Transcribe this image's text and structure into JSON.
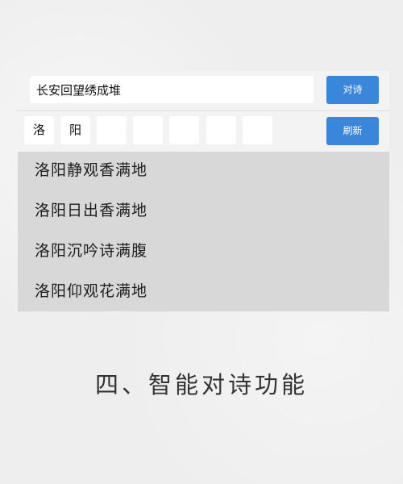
{
  "search": {
    "value": "长安回望绣成堆"
  },
  "buttons": {
    "duishi_label": "对诗",
    "refresh_label": "刷新"
  },
  "slots": [
    "洛",
    "阳",
    "",
    "",
    "",
    "",
    ""
  ],
  "results": [
    "洛阳静观香满地",
    "洛阳日出香满地",
    "洛阳沉吟诗满腹",
    "洛阳仰观花满地"
  ],
  "caption": "四、智能对诗功能"
}
